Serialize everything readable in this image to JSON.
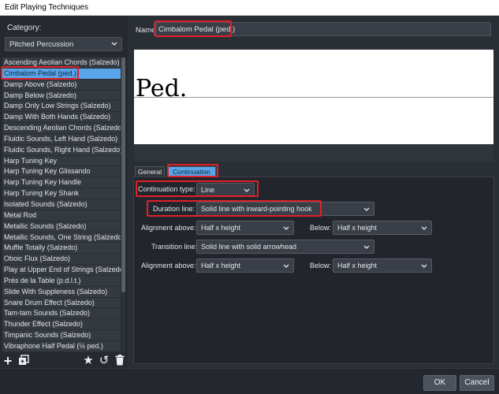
{
  "window": {
    "title": "Edit Playing Techniques"
  },
  "sidebar": {
    "category_label": "Category:",
    "category_value": "Pitched Percussion",
    "items": [
      {
        "label": "Ascending Aeolian Chords (Salzedo)"
      },
      {
        "label": "Cimbalom Pedal (ped.)",
        "selected": true
      },
      {
        "label": "Damp Above (Salzedo)"
      },
      {
        "label": "Damp Below (Salzedo)"
      },
      {
        "label": "Damp Only Low Strings (Salzedo)"
      },
      {
        "label": "Damp With Both Hands (Salzedo)"
      },
      {
        "label": "Descending Aeolian Chords (Salzedo)"
      },
      {
        "label": "Fluidic Sounds, Left Hand (Salzedo)"
      },
      {
        "label": "Fluidic Sounds, Right Hand (Salzedo)"
      },
      {
        "label": "Harp Tuning Key"
      },
      {
        "label": "Harp Tuning Key Glissando"
      },
      {
        "label": "Harp Tuning Key Handle"
      },
      {
        "label": "Harp Tuning Key Shank"
      },
      {
        "label": "Isolated Sounds (Salzedo)"
      },
      {
        "label": "Metal Rod"
      },
      {
        "label": "Metallic Sounds (Salzedo)"
      },
      {
        "label": "Metallic Sounds, One String (Salzedo)"
      },
      {
        "label": "Muffle Totally (Salzedo)"
      },
      {
        "label": "Oboic Flux (Salzedo)"
      },
      {
        "label": "Play at Upper End of Strings (Salzedo)"
      },
      {
        "label": "Près de la Table (p.d.l.t.)"
      },
      {
        "label": "Slide With Suppleness (Salzedo)"
      },
      {
        "label": "Snare Drum Effect (Salzedo)"
      },
      {
        "label": "Tam-tam Sounds (Salzedo)"
      },
      {
        "label": "Thunder Effect (Salzedo)"
      },
      {
        "label": "Timpanic Sounds (Salzedo)"
      },
      {
        "label": "Vibraphone Half Pedal (½ ped.)"
      }
    ],
    "tools": {
      "add": "+",
      "star": "★",
      "reset": "↺"
    }
  },
  "editor": {
    "name_label": "Name:",
    "name_value": "Cimbalom Pedal (ped.)",
    "preview_text": "Ped.",
    "tabs": [
      {
        "label": "General"
      },
      {
        "label": "Continuation",
        "active": true
      }
    ],
    "continuation": {
      "type_label": "Continuation type:",
      "type_value": "Line",
      "duration_label": "Duration line:",
      "duration_value": "Solid line with inward-pointing hook",
      "align_above_label": "Alignment above:",
      "align_above_value": "Half x height",
      "below_label": "Below:",
      "below_value": "Half x height",
      "transition_label": "Transition line:",
      "transition_value": "Solid line with solid arrowhead",
      "align_above2_label": "Alignment above:",
      "align_above2_value": "Half x height",
      "below2_label": "Below:",
      "below2_value": "Half x height"
    }
  },
  "footer": {
    "ok_label": "OK",
    "cancel_label": "Cancel"
  },
  "colors": {
    "accent": "#5aa6ea",
    "highlight": "#e0202a",
    "panel": "#2a2e35"
  }
}
